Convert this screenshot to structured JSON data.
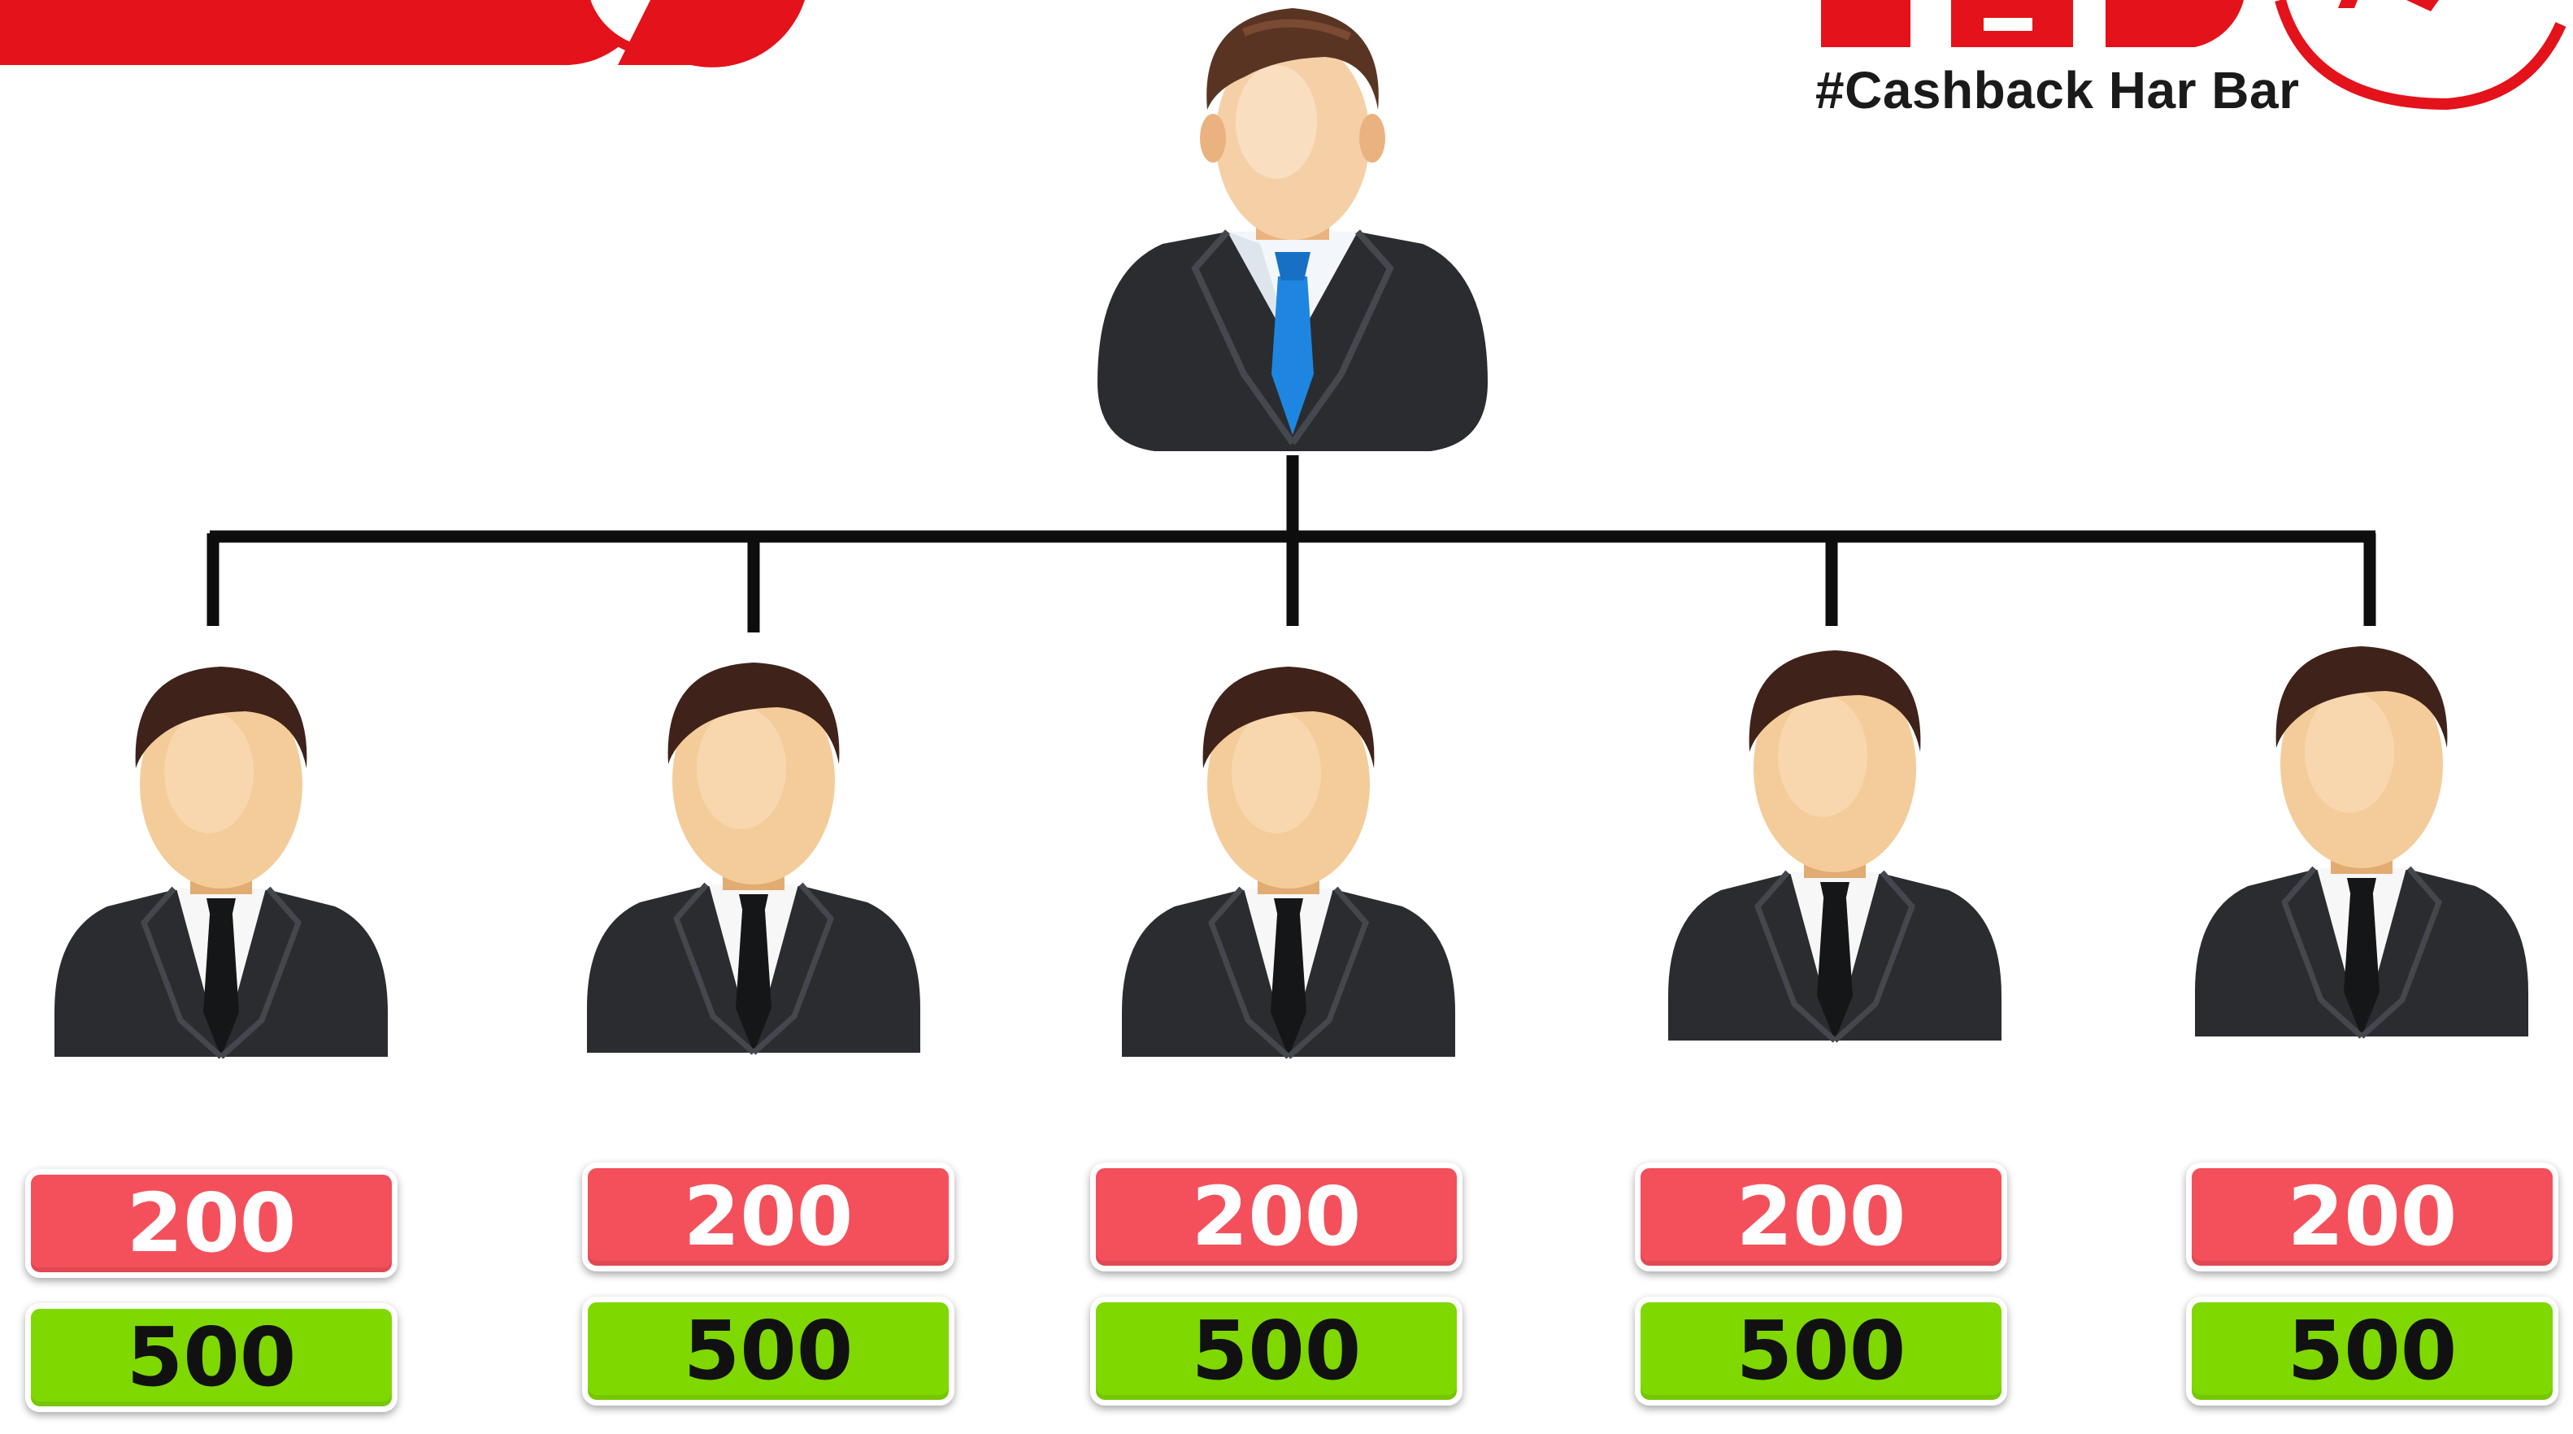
{
  "brand": {
    "tagline": "#Cashback Har Bar",
    "logo_text": "ZED",
    "accent_color": "#e4121a"
  },
  "root": {
    "icon": "businessman-blue-tie-icon"
  },
  "children": [
    {
      "icon": "businessman-icon",
      "top_value": "200",
      "bottom_value": "500"
    },
    {
      "icon": "businessman-icon",
      "top_value": "200",
      "bottom_value": "500"
    },
    {
      "icon": "businessman-icon",
      "top_value": "200",
      "bottom_value": "500"
    },
    {
      "icon": "businessman-icon",
      "top_value": "200",
      "bottom_value": "500"
    },
    {
      "icon": "businessman-icon",
      "top_value": "200",
      "bottom_value": "500"
    }
  ],
  "colors": {
    "top_badge": "#f4505b",
    "bottom_badge": "#7fd800",
    "connector": "#0d0d0d",
    "tie_root": "#1e86e0",
    "suit": "#2a2c30",
    "skin": "#f4cc9a",
    "hair": "#3f2219"
  }
}
